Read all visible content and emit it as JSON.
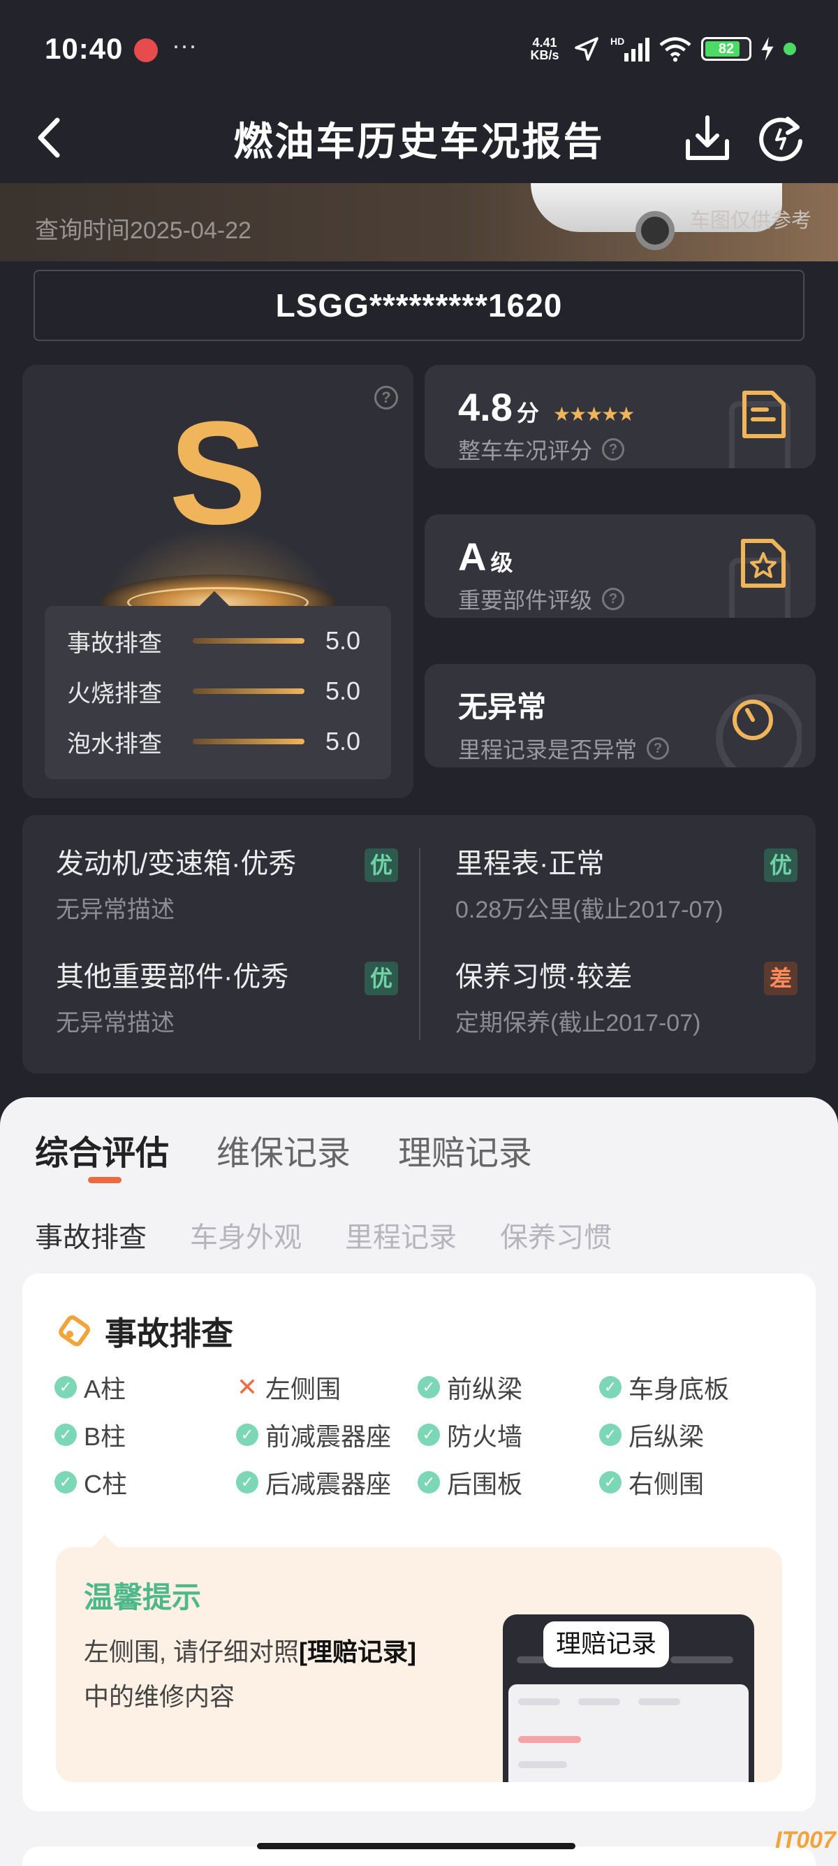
{
  "status_bar": {
    "time": "10:40",
    "dots": "···",
    "net_speed_top": "4.41",
    "net_speed_unit": "KB/s",
    "battery": "82",
    "battery_level": 0.82
  },
  "nav": {
    "title": "燃油车历史车况报告"
  },
  "banner": {
    "query_time": "查询时间2025-04-22",
    "car_note": "车图仅供参考"
  },
  "vin": "LSGG*********1620",
  "grade": {
    "letter": "S",
    "checks": [
      {
        "label": "事故排查",
        "score": "5.0"
      },
      {
        "label": "火烧排查",
        "score": "5.0"
      },
      {
        "label": "泡水排查",
        "score": "5.0"
      }
    ]
  },
  "stats": {
    "score": {
      "value": "4.8",
      "unit": "分",
      "stars": "★★★★★",
      "label": "整车车况评分"
    },
    "parts": {
      "value": "A",
      "unit": "级",
      "label": "重要部件评级"
    },
    "mileage": {
      "value": "无异常",
      "label": "里程记录是否异常"
    }
  },
  "summary": {
    "engine": {
      "title": "发动机/变速箱·优秀",
      "sub": "无异常描述",
      "tag": "优"
    },
    "odometer": {
      "title": "里程表·正常",
      "sub": "0.28万公里(截止2017-07)",
      "tag": "优"
    },
    "other": {
      "title": "其他重要部件·优秀",
      "sub": "无异常描述",
      "tag": "优"
    },
    "maintenance": {
      "title": "保养习惯·较差",
      "sub": "定期保养(截止2017-07)",
      "tag": "差"
    }
  },
  "tabs": [
    "综合评估",
    "维保记录",
    "理赔记录"
  ],
  "subtabs": [
    "事故排查",
    "车身外观",
    "里程记录",
    "保养习惯"
  ],
  "accident": {
    "title": "事故排查",
    "parts": [
      {
        "label": "A柱",
        "ok": true
      },
      {
        "label": "左侧围",
        "ok": false
      },
      {
        "label": "前纵梁",
        "ok": true
      },
      {
        "label": "车身底板",
        "ok": true
      },
      {
        "label": "B柱",
        "ok": true
      },
      {
        "label": "前减震器座",
        "ok": true
      },
      {
        "label": "防火墙",
        "ok": true
      },
      {
        "label": "后纵梁",
        "ok": true
      },
      {
        "label": "C柱",
        "ok": true
      },
      {
        "label": "后减震器座",
        "ok": true
      },
      {
        "label": "后围板",
        "ok": true
      },
      {
        "label": "右侧围",
        "ok": true
      }
    ]
  },
  "tip": {
    "title": "温馨提示",
    "body_prefix": "左侧围, 请仔细对照",
    "body_link": "[理赔记录]",
    "body_suffix": "中的维修内容",
    "bubble": "理赔记录"
  },
  "watermark": "IT007",
  "colors": {
    "accent": "#f0b45a",
    "tab_underline": "#ec6a3e",
    "good": "#6fd2a8",
    "bad": "#ff8a5a",
    "tip_title": "#4fb88a"
  }
}
